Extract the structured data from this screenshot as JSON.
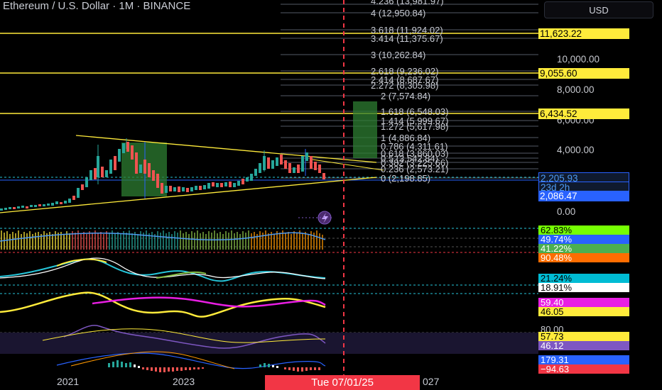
{
  "header": {
    "title": "Ethereum / U.S. Dollar · 1M · BINANCE"
  },
  "currency_button": {
    "label": "USD"
  },
  "price_axis": {
    "labels": [
      "10,000.00",
      "8,000.00",
      "6,000.00",
      "4,000.00",
      "0.00"
    ],
    "badges": [
      {
        "text": "11,623.22",
        "bg": "#ffeb3b",
        "color": "#000000"
      },
      {
        "text": "9,055.60",
        "bg": "#ffeb3b",
        "color": "#000000"
      },
      {
        "text": "6,434.52",
        "bg": "#ffeb3b",
        "color": "#000000"
      },
      {
        "text": "2,205.93",
        "bg": "#0f1a2e",
        "color": "#4e9af1"
      },
      {
        "text": "23d 2h",
        "bg": "#0f1a2e",
        "color": "#4e9af1"
      },
      {
        "text": "2,086.47",
        "bg": "#2962ff",
        "color": "#ffffff"
      }
    ]
  },
  "fib_levels": [
    "4.236 (13,981.97)",
    "4 (12,950.84)",
    "3.618 (11,924.02)",
    "3.414 (11,375.67)",
    "3 (10,262.84)",
    "2.618 (9,236.02)",
    "2.414 (8,687.67)",
    "2.272 (8,305.98)",
    "2 (7,574.84)",
    "1.618 (6,548.03)",
    "1.414 (5,999.67)",
    "1.272 (5,617.98)",
    "1 (4,886.84)",
    "0.786 (4,311.61)",
    "0.618 (3,860.03)",
    "0.5 (3,542.84)",
    "0.382 (3,225.66)",
    "0.236 (2,573.21)",
    "0 (2,198.85)"
  ],
  "indicators": [
    {
      "text": "62.83%",
      "bg": "#76ff03",
      "color": "#000000"
    },
    {
      "text": "49.74%",
      "bg": "#2962ff",
      "color": "#ffffff"
    },
    {
      "text": "41.22%",
      "bg": "#4caf50",
      "color": "#ffffff"
    },
    {
      "text": "90.48%",
      "bg": "#ff6d00",
      "color": "#ffffff"
    },
    {
      "text": "21.24%",
      "bg": "#00bcd4",
      "color": "#000000"
    },
    {
      "text": "18.91%",
      "bg": "#ffffff",
      "color": "#000000"
    },
    {
      "text": "59.40",
      "bg": "#e91ee3",
      "color": "#ffffff"
    },
    {
      "text": "46.05",
      "bg": "#ffeb3b",
      "color": "#000000"
    },
    {
      "text": "80.00",
      "bg": "transparent",
      "color": "#c7c9cf"
    },
    {
      "text": "57.73",
      "bg": "#ffeb3b",
      "color": "#000000"
    },
    {
      "text": "46.12",
      "bg": "#7e57c2",
      "color": "#ffffff"
    },
    {
      "text": "179.31",
      "bg": "#2962ff",
      "color": "#ffffff"
    },
    {
      "text": "−94.63",
      "bg": "#f23645",
      "color": "#ffffff"
    }
  ],
  "time_axis": {
    "labels": [
      "2021",
      "2023",
      "027"
    ],
    "cursor_date": "Tue 07/01/25"
  },
  "colors": {
    "accent_yellow": "#ffeb3b",
    "bull": "#26a69a",
    "bear": "#ef5350",
    "cursor": "#f23645"
  }
}
